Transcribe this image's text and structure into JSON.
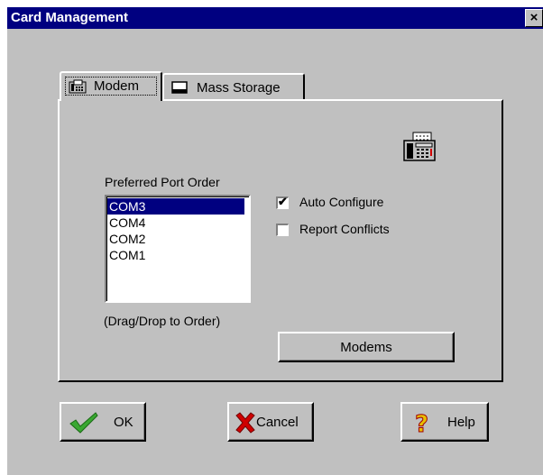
{
  "window": {
    "title": "Card Management",
    "close_glyph": "×"
  },
  "tabs": [
    {
      "label": "Modem",
      "icon": "modem-icon",
      "active": true
    },
    {
      "label": "Mass Storage",
      "icon": "drive-icon",
      "active": false
    }
  ],
  "modem_panel": {
    "port_order_label": "Preferred Port Order",
    "ports": [
      "COM3",
      "COM4",
      "COM2",
      "COM1"
    ],
    "selected_port": "COM3",
    "hint": "(Drag/Drop to Order)",
    "auto_configure": {
      "label": "Auto Configure",
      "checked": true
    },
    "report_conflicts": {
      "label": "Report Conflicts",
      "checked": false
    },
    "modems_button": "Modems",
    "fax_icon": "fax-machine-icon"
  },
  "buttons": {
    "ok": {
      "label": "OK",
      "icon": "checkmark-icon"
    },
    "cancel": {
      "label": "Cancel",
      "icon": "red-x-icon"
    },
    "help": {
      "label": "Help",
      "icon": "question-mark-icon"
    }
  },
  "colors": {
    "face": "#c0c0c0",
    "titlebar": "#000080",
    "selection": "#000080",
    "ok_check": "#3aa832",
    "cancel_x": "#d00000",
    "help_q": "#e8c000"
  }
}
